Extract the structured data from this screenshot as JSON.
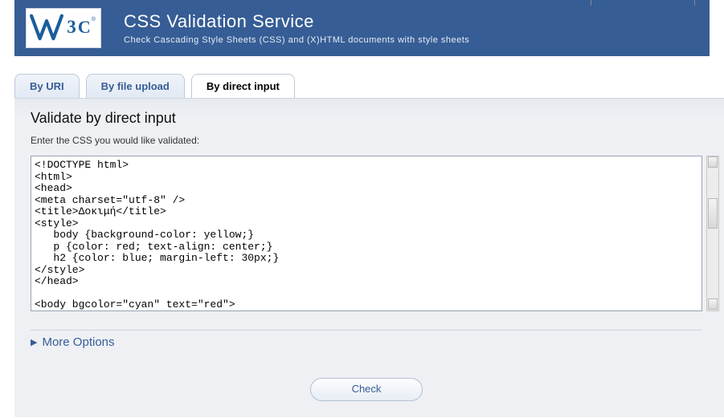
{
  "header": {
    "title": "CSS Validation Service",
    "subtitle": "Check Cascading Style Sheets (CSS) and (X)HTML documents with style sheets",
    "logo_text": "W3C"
  },
  "tabs": {
    "by_uri": "By URI",
    "by_file_upload": "By file upload",
    "by_direct_input": "By direct input"
  },
  "form": {
    "section_title": "Validate by direct input",
    "instruction": "Enter the CSS you would like validated:",
    "textarea_value": "<!DOCTYPE html>\n<html>\n<head>\n<meta charset=\"utf-8\" />\n<title>Δοκιμή</title>\n<style>\n   body {background-color: yellow;}\n   p {color: red; text-align: center;}\n   h2 {color: blue; margin-left: 30px;}\n</style>\n</head>\n\n<body bgcolor=\"cyan\" text=\"red\">",
    "more_options_label": "More Options",
    "check_button_label": "Check"
  }
}
